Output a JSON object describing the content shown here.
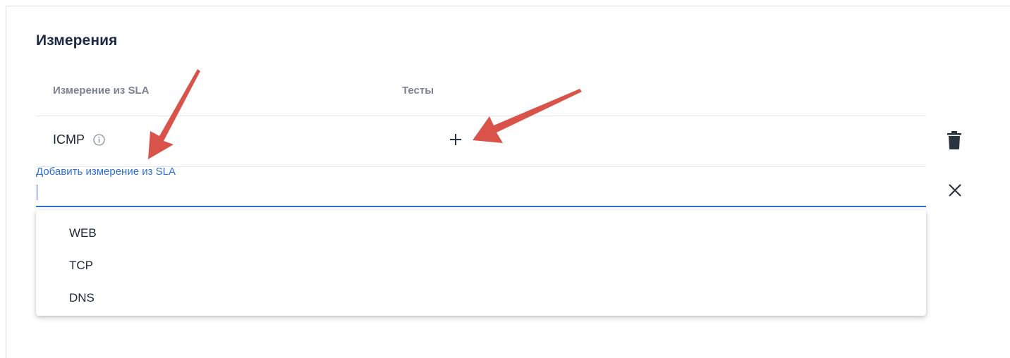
{
  "section": {
    "title": "Измерения"
  },
  "table": {
    "columns": [
      "Измерение из SLA",
      "Тесты"
    ],
    "rows": [
      {
        "name": "ICMP"
      }
    ]
  },
  "add_field": {
    "label": "Добавить измерение из SLA",
    "value": ""
  },
  "dropdown": {
    "options": [
      "WEB",
      "TCP",
      "DNS"
    ]
  },
  "icons": {
    "info": "info-icon",
    "add": "plus-icon",
    "delete": "trash-icon",
    "clear": "close-icon"
  },
  "colors": {
    "accent": "#2e6fd3",
    "annotation_arrow": "#d9534a",
    "title": "#1d2b47",
    "header_text": "#7b8390"
  }
}
